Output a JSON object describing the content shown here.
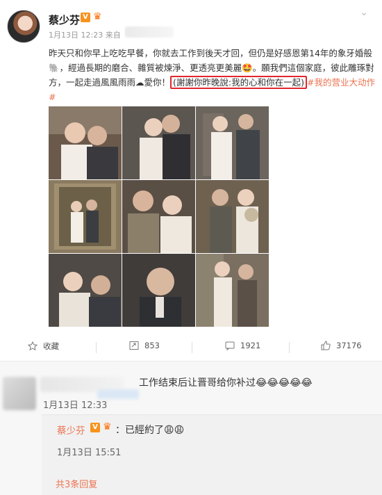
{
  "post": {
    "author": "蔡少芬",
    "verified_badge": "V",
    "meta": "1月13日 12:23 来自",
    "text_before": "昨天只和你早上吃吃早餐，你就去工作到後天才回，但仍是好感恩第14年的象牙婚般🐘，經過長期的磨合、雜質被煉淨、更透亮更美麗🤩。願我們這個家庭，彼此雕琢對方，一起走過風風雨雨☁愛你！",
    "text_highlight": "(謝謝你昨晚說:我的心和你在一起)",
    "text_tag": "#我的营业大动作#",
    "actions": {
      "favorite": "收藏",
      "repost": "853",
      "comment": "1921",
      "like": "37176"
    }
  },
  "comments": {
    "first_text": "工作结束后让晋哥给你补过😂😂😂😂😂",
    "first_date": "1月13日 12:33",
    "reply_author": "蔡少芬",
    "reply_text": "：已經約了😩😩",
    "reply_date": "1月13日 15:51",
    "more_replies": "共3条回复"
  },
  "colors": {
    "accent": "#eb7350",
    "highlight_box": "#e2262b",
    "badge": "#f7931e"
  }
}
